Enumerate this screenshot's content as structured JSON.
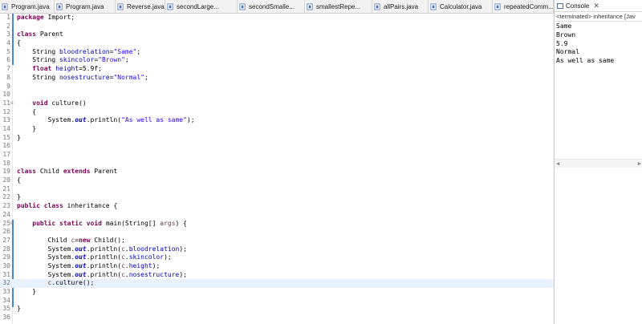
{
  "tabs": [
    {
      "label": "Program.java",
      "width": 68
    },
    {
      "label": "Program.java",
      "width": 76
    },
    {
      "label": "Reverse.java",
      "width": 62
    },
    {
      "label": "secondLarge...",
      "width": 90
    },
    {
      "label": "secondSmalle...",
      "width": 84
    },
    {
      "label": "smallestRepe...",
      "width": 84
    },
    {
      "label": "allPairs.java",
      "width": 70
    },
    {
      "label": "Calculator.java",
      "width": 80
    },
    {
      "label": "repeatedComm...",
      "width": 76
    }
  ],
  "code_lines": [
    {
      "n": "1",
      "seg": [
        {
          "t": "package",
          "c": "kw"
        },
        {
          "t": " Import;"
        }
      ]
    },
    {
      "n": "2",
      "seg": []
    },
    {
      "n": "3",
      "seg": [
        {
          "t": "class",
          "c": "kw"
        },
        {
          "t": " Parent"
        }
      ]
    },
    {
      "n": "4",
      "seg": [
        {
          "t": "{"
        }
      ]
    },
    {
      "n": "5",
      "seg": [
        {
          "t": "    String "
        },
        {
          "t": "bloodrelation",
          "c": "fld"
        },
        {
          "t": "="
        },
        {
          "t": "\"Same\"",
          "c": "str"
        },
        {
          "t": ";"
        }
      ]
    },
    {
      "n": "6",
      "seg": [
        {
          "t": "    String "
        },
        {
          "t": "skincolor",
          "c": "fld"
        },
        {
          "t": "="
        },
        {
          "t": "\"Brown\"",
          "c": "str"
        },
        {
          "t": ";"
        }
      ]
    },
    {
      "n": "7",
      "seg": [
        {
          "t": "    "
        },
        {
          "t": "float",
          "c": "kw"
        },
        {
          "t": " "
        },
        {
          "t": "height",
          "c": "fld"
        },
        {
          "t": "=5.9f;"
        }
      ]
    },
    {
      "n": "8",
      "seg": [
        {
          "t": "    String "
        },
        {
          "t": "nosestructure",
          "c": "fld"
        },
        {
          "t": "="
        },
        {
          "t": "\"Normal\"",
          "c": "str"
        },
        {
          "t": ";"
        }
      ]
    },
    {
      "n": "9",
      "seg": []
    },
    {
      "n": "10",
      "seg": []
    },
    {
      "n": "11",
      "fold": true,
      "seg": [
        {
          "t": "    "
        },
        {
          "t": "void",
          "c": "kw"
        },
        {
          "t": " culture()"
        }
      ]
    },
    {
      "n": "12",
      "seg": [
        {
          "t": "    {"
        }
      ]
    },
    {
      "n": "13",
      "seg": [
        {
          "t": "        System."
        },
        {
          "t": "out",
          "c": "sfld"
        },
        {
          "t": ".println("
        },
        {
          "t": "\"As well as same\"",
          "c": "str"
        },
        {
          "t": ");"
        }
      ]
    },
    {
      "n": "14",
      "seg": [
        {
          "t": "    }"
        }
      ]
    },
    {
      "n": "15",
      "seg": [
        {
          "t": "}"
        }
      ]
    },
    {
      "n": "16",
      "seg": []
    },
    {
      "n": "17",
      "seg": []
    },
    {
      "n": "18",
      "seg": []
    },
    {
      "n": "19",
      "seg": [
        {
          "t": "class",
          "c": "kw"
        },
        {
          "t": " Child "
        },
        {
          "t": "extends",
          "c": "kw"
        },
        {
          "t": " Parent"
        }
      ]
    },
    {
      "n": "20",
      "seg": [
        {
          "t": "{"
        }
      ]
    },
    {
      "n": "21",
      "seg": []
    },
    {
      "n": "22",
      "seg": [
        {
          "t": "}"
        }
      ]
    },
    {
      "n": "23",
      "seg": [
        {
          "t": "public",
          "c": "kw"
        },
        {
          "t": " "
        },
        {
          "t": "class",
          "c": "kw"
        },
        {
          "t": " inheritance {"
        }
      ]
    },
    {
      "n": "24",
      "seg": []
    },
    {
      "n": "25",
      "fold": true,
      "seg": [
        {
          "t": "    "
        },
        {
          "t": "public",
          "c": "kw"
        },
        {
          "t": " "
        },
        {
          "t": "static",
          "c": "kw"
        },
        {
          "t": " "
        },
        {
          "t": "void",
          "c": "kw"
        },
        {
          "t": " main(String[] "
        },
        {
          "t": "args",
          "c": "param"
        },
        {
          "t": ") {"
        }
      ]
    },
    {
      "n": "26",
      "seg": []
    },
    {
      "n": "27",
      "seg": [
        {
          "t": "        Child "
        },
        {
          "t": "c",
          "c": "param"
        },
        {
          "t": "="
        },
        {
          "t": "new",
          "c": "kw"
        },
        {
          "t": " Child();"
        }
      ]
    },
    {
      "n": "28",
      "seg": [
        {
          "t": "        System."
        },
        {
          "t": "out",
          "c": "sfld"
        },
        {
          "t": ".println("
        },
        {
          "t": "c",
          "c": "param"
        },
        {
          "t": "."
        },
        {
          "t": "bloodrelation",
          "c": "fld"
        },
        {
          "t": ");"
        }
      ]
    },
    {
      "n": "29",
      "seg": [
        {
          "t": "        System."
        },
        {
          "t": "out",
          "c": "sfld"
        },
        {
          "t": ".println("
        },
        {
          "t": "c",
          "c": "param"
        },
        {
          "t": "."
        },
        {
          "t": "skincolor",
          "c": "fld"
        },
        {
          "t": ");"
        }
      ]
    },
    {
      "n": "30",
      "seg": [
        {
          "t": "        System."
        },
        {
          "t": "out",
          "c": "sfld"
        },
        {
          "t": ".println("
        },
        {
          "t": "c",
          "c": "param"
        },
        {
          "t": "."
        },
        {
          "t": "height",
          "c": "fld"
        },
        {
          "t": ");"
        }
      ]
    },
    {
      "n": "31",
      "seg": [
        {
          "t": "        System."
        },
        {
          "t": "out",
          "c": "sfld"
        },
        {
          "t": ".println("
        },
        {
          "t": "c",
          "c": "param"
        },
        {
          "t": "."
        },
        {
          "t": "nosestructure",
          "c": "fld"
        },
        {
          "t": ");"
        }
      ]
    },
    {
      "n": "32",
      "hl": true,
      "seg": [
        {
          "t": "        "
        },
        {
          "t": "c",
          "c": "param"
        },
        {
          "t": ".culture();"
        }
      ]
    },
    {
      "n": "33",
      "seg": [
        {
          "t": "    }"
        }
      ]
    },
    {
      "n": "34",
      "seg": []
    },
    {
      "n": "35",
      "seg": [
        {
          "t": "}"
        }
      ]
    },
    {
      "n": "36",
      "seg": []
    }
  ],
  "console": {
    "tab_label": "Console",
    "close_glyph": "✕",
    "status": "<terminated> inheritance [Jav",
    "output": [
      "Same",
      "Brown",
      "5.9",
      "Normal",
      "As well as same"
    ]
  },
  "colors": {
    "keyword": "#7f0055",
    "string": "#2a00ff",
    "field": "#0000c0",
    "highlight": "#e8f2fe"
  }
}
